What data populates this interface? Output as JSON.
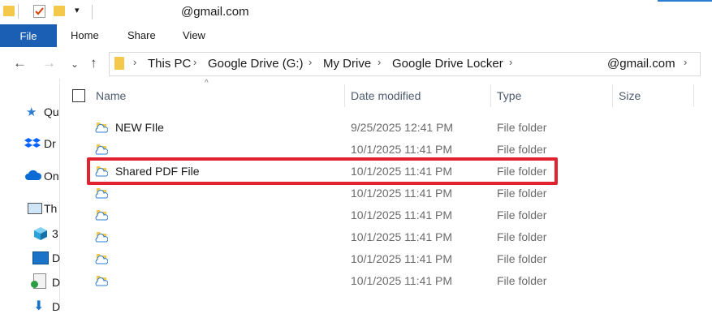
{
  "window": {
    "title": "@gmail.com"
  },
  "ribbon": {
    "tabs": [
      "File",
      "Home",
      "Share",
      "View"
    ]
  },
  "address": {
    "crumbs": [
      "This PC",
      "Google Drive (G:)",
      "My Drive",
      "Google Drive Locker"
    ],
    "account": "@gmail.com"
  },
  "navpane": {
    "items": [
      {
        "label": "Qu",
        "icon": "star-icon"
      },
      {
        "label": "Dr",
        "icon": "dropbox-icon"
      },
      {
        "label": "On",
        "icon": "cloud-icon"
      },
      {
        "label": "Th",
        "icon": "pc-icon"
      },
      {
        "label": "3",
        "icon": "cube-icon"
      },
      {
        "label": "D",
        "icon": "desktop-icon"
      },
      {
        "label": "D",
        "icon": "document-icon"
      },
      {
        "label": "D",
        "icon": "download-icon"
      }
    ]
  },
  "columns": {
    "name": "Name",
    "date": "Date modified",
    "type": "Type",
    "size": "Size"
  },
  "rows": [
    {
      "name": "NEW FIle",
      "date": "9/25/2025 12:41 PM",
      "type": "File folder"
    },
    {
      "name": "",
      "date": "10/1/2025 11:41 PM",
      "type": "File folder"
    },
    {
      "name": "Shared PDF File",
      "date": "10/1/2025 11:41 PM",
      "type": "File folder"
    },
    {
      "name": "",
      "date": "10/1/2025 11:41 PM",
      "type": "File folder"
    },
    {
      "name": "",
      "date": "10/1/2025 11:41 PM",
      "type": "File folder"
    },
    {
      "name": "",
      "date": "10/1/2025 11:41 PM",
      "type": "File folder"
    },
    {
      "name": "",
      "date": "10/1/2025 11:41 PM",
      "type": "File folder"
    },
    {
      "name": "",
      "date": "10/1/2025 11:41 PM",
      "type": "File folder"
    }
  ],
  "highlight_color": "#e0232e",
  "accent_color": "#1a5fb4"
}
